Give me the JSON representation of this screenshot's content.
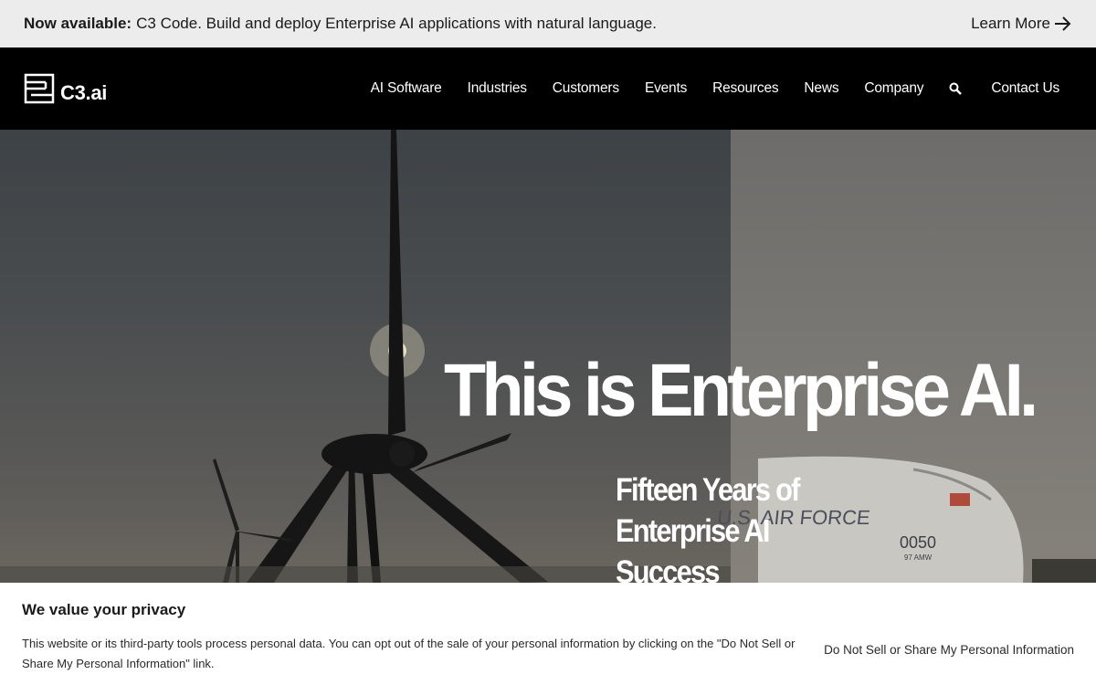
{
  "announcement": {
    "bold": "Now available:",
    "text": "C3 Code. Build and deploy Enterprise AI applications with natural language.",
    "link": "Learn More",
    "link_icon": "arrow-right-icon"
  },
  "nav": {
    "logo_text": "C3.ai",
    "items": [
      "AI Software",
      "Industries",
      "Customers",
      "Events",
      "Resources",
      "News",
      "Company"
    ],
    "search_icon": "search-icon",
    "contact": "Contact Us"
  },
  "hero": {
    "headline": "This is Enterprise AI.",
    "subhead_lines": [
      "Fifteen Years of",
      "Enterprise AI",
      "Success"
    ],
    "plane_text": "U.S. AIR FORCE",
    "plane_number": "0050",
    "plane_sub": "97 AMW"
  },
  "privacy": {
    "title": "We value your privacy",
    "body": "This website or its third-party tools process personal data. You can opt out of the sale of your personal information by clicking on the \"Do Not Sell or Share My Personal Information\" link.",
    "link": "Do Not Sell or Share My Personal Information"
  },
  "colors": {
    "announcement_bg": "#ececec",
    "nav_bg": "#000000",
    "text_white": "#ffffff"
  }
}
